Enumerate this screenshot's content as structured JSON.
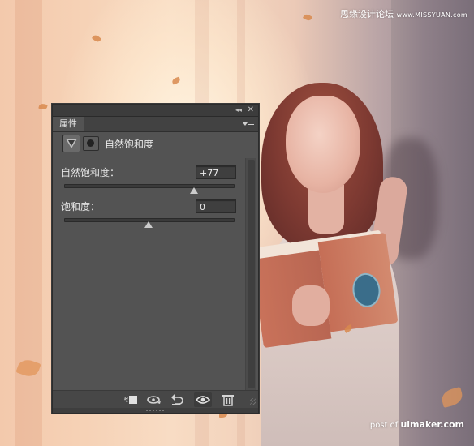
{
  "watermarks": {
    "top_cn": "思缘设计论坛",
    "top_site": "www.MISSYUAN.com",
    "bottom_prefix": "post of",
    "bottom_site": "uimaker.com"
  },
  "panel": {
    "tab_label": "属性",
    "adjustment_title": "自然饱和度",
    "vibrance": {
      "label": "自然饱和度：",
      "value": "+77",
      "slider_percent": 77
    },
    "saturation": {
      "label": "饱和度：",
      "value": "0",
      "slider_percent": 50
    },
    "titlebar": {
      "collapse_glyph": "◂◂",
      "close_glyph": "✕"
    },
    "bottom_icons": [
      "clip-to-layer-icon",
      "view-previous-state-icon",
      "reset-icon",
      "visibility-eye-icon",
      "delete-trash-icon"
    ]
  },
  "colors": {
    "panel_bg": "#535353",
    "titlebar_bg": "#3c3c3c",
    "field_bg": "#3f3f3f"
  }
}
